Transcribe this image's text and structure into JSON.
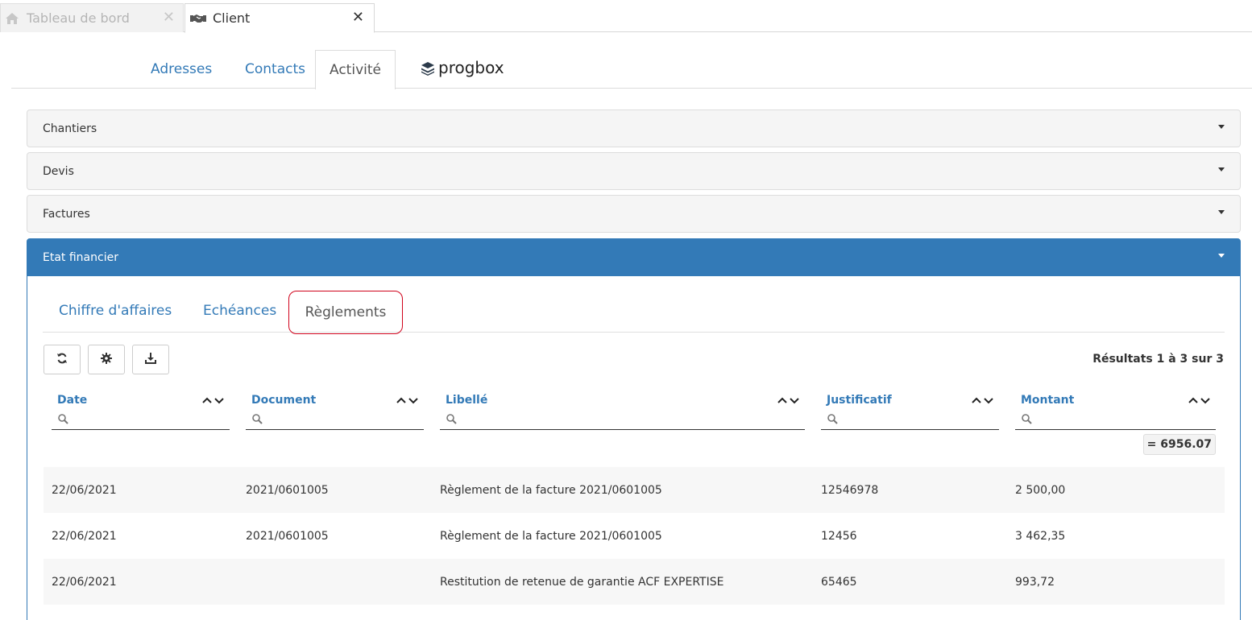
{
  "app_tabs": [
    {
      "label": "Tableau de bord",
      "icon": "home-icon",
      "state": "inactive"
    },
    {
      "label": "Client",
      "icon": "handshake-icon",
      "state": "active"
    }
  ],
  "client_nav": {
    "tabs": [
      "Adresses",
      "Contacts",
      "Activité"
    ],
    "active": "Activité",
    "logo_text": "progbox"
  },
  "panels": [
    {
      "title": "Chantiers",
      "open": false
    },
    {
      "title": "Devis",
      "open": false
    },
    {
      "title": "Factures",
      "open": false
    },
    {
      "title": "Etat financier",
      "open": true
    }
  ],
  "financial": {
    "tabs": [
      "Chiffre d'affaires",
      "Echéances",
      "Règlements"
    ],
    "active_tab": "Règlements",
    "toolbar": [
      "refresh-icon",
      "gear-icon",
      "download-icon"
    ],
    "results_text": "Résultats 1 à 3 sur 3",
    "columns": [
      "Date",
      "Document",
      "Libellé",
      "Justificatif",
      "Montant"
    ],
    "total": "= 6956.07",
    "rows": [
      {
        "date": "22/06/2021",
        "document": "2021/0601005",
        "libelle": "Règlement de la facture 2021/0601005",
        "justificatif": "12546978",
        "montant": "2 500,00"
      },
      {
        "date": "22/06/2021",
        "document": "2021/0601005",
        "libelle": "Règlement de la facture 2021/0601005",
        "justificatif": "12456",
        "montant": "3 462,35"
      },
      {
        "date": "22/06/2021",
        "document": "",
        "libelle": "Restitution de retenue de garantie ACF EXPERTISE",
        "justificatif": "65465",
        "montant": "993,72"
      }
    ]
  },
  "colors": {
    "accent": "#337ab7",
    "highlight": "#d0021b"
  }
}
